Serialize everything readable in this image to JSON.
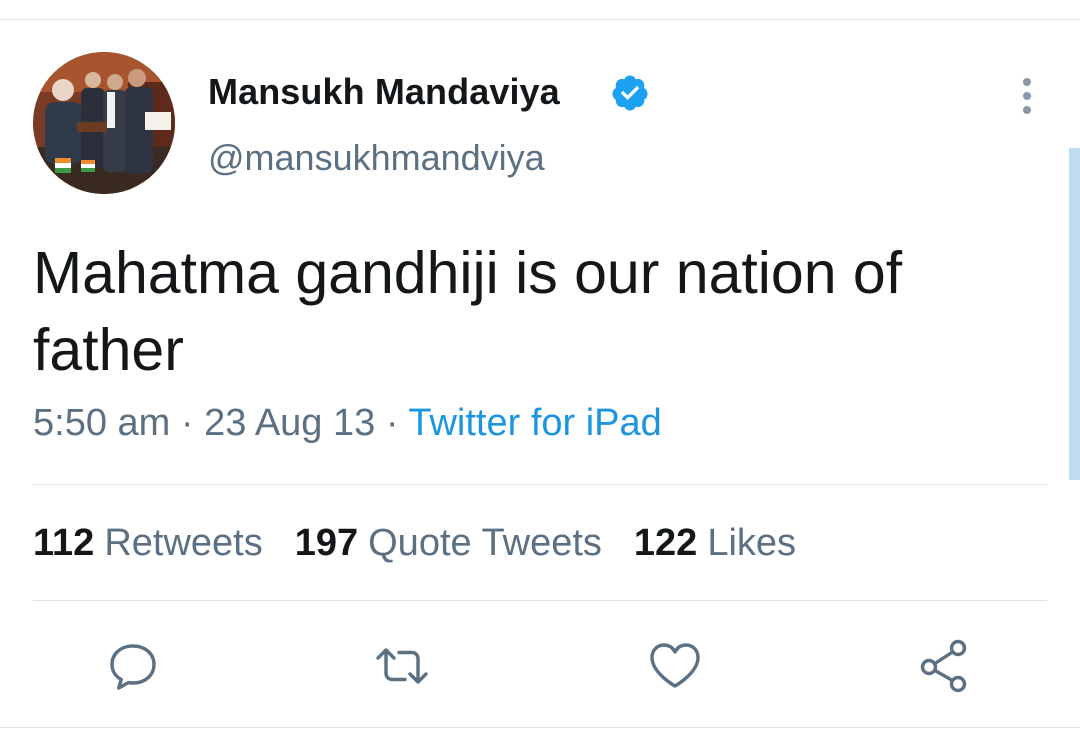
{
  "tweet": {
    "display_name": "Mansukh Mandaviya",
    "handle": "@mansukhmandviya",
    "text": "Mahatma gandhiji is our nation of\nfather",
    "time": "5:50 am",
    "date": "23 Aug 13",
    "separator": "·",
    "source": "Twitter for iPad"
  },
  "stats": {
    "retweets_count": "112",
    "retweets_label": "Retweets",
    "quote_count": "197",
    "quote_label": "Quote Tweets",
    "likes_count": "122",
    "likes_label": "Likes"
  },
  "icons": {
    "verified": "verified-badge-icon",
    "more": "more-vertical-icon",
    "reply": "reply-icon",
    "retweet": "retweet-icon",
    "like": "heart-icon",
    "share": "share-icon"
  },
  "colors": {
    "accent": "#1b95e0",
    "verified": "#1da1f2",
    "text": "#14171a",
    "secondary": "#5b7083"
  }
}
